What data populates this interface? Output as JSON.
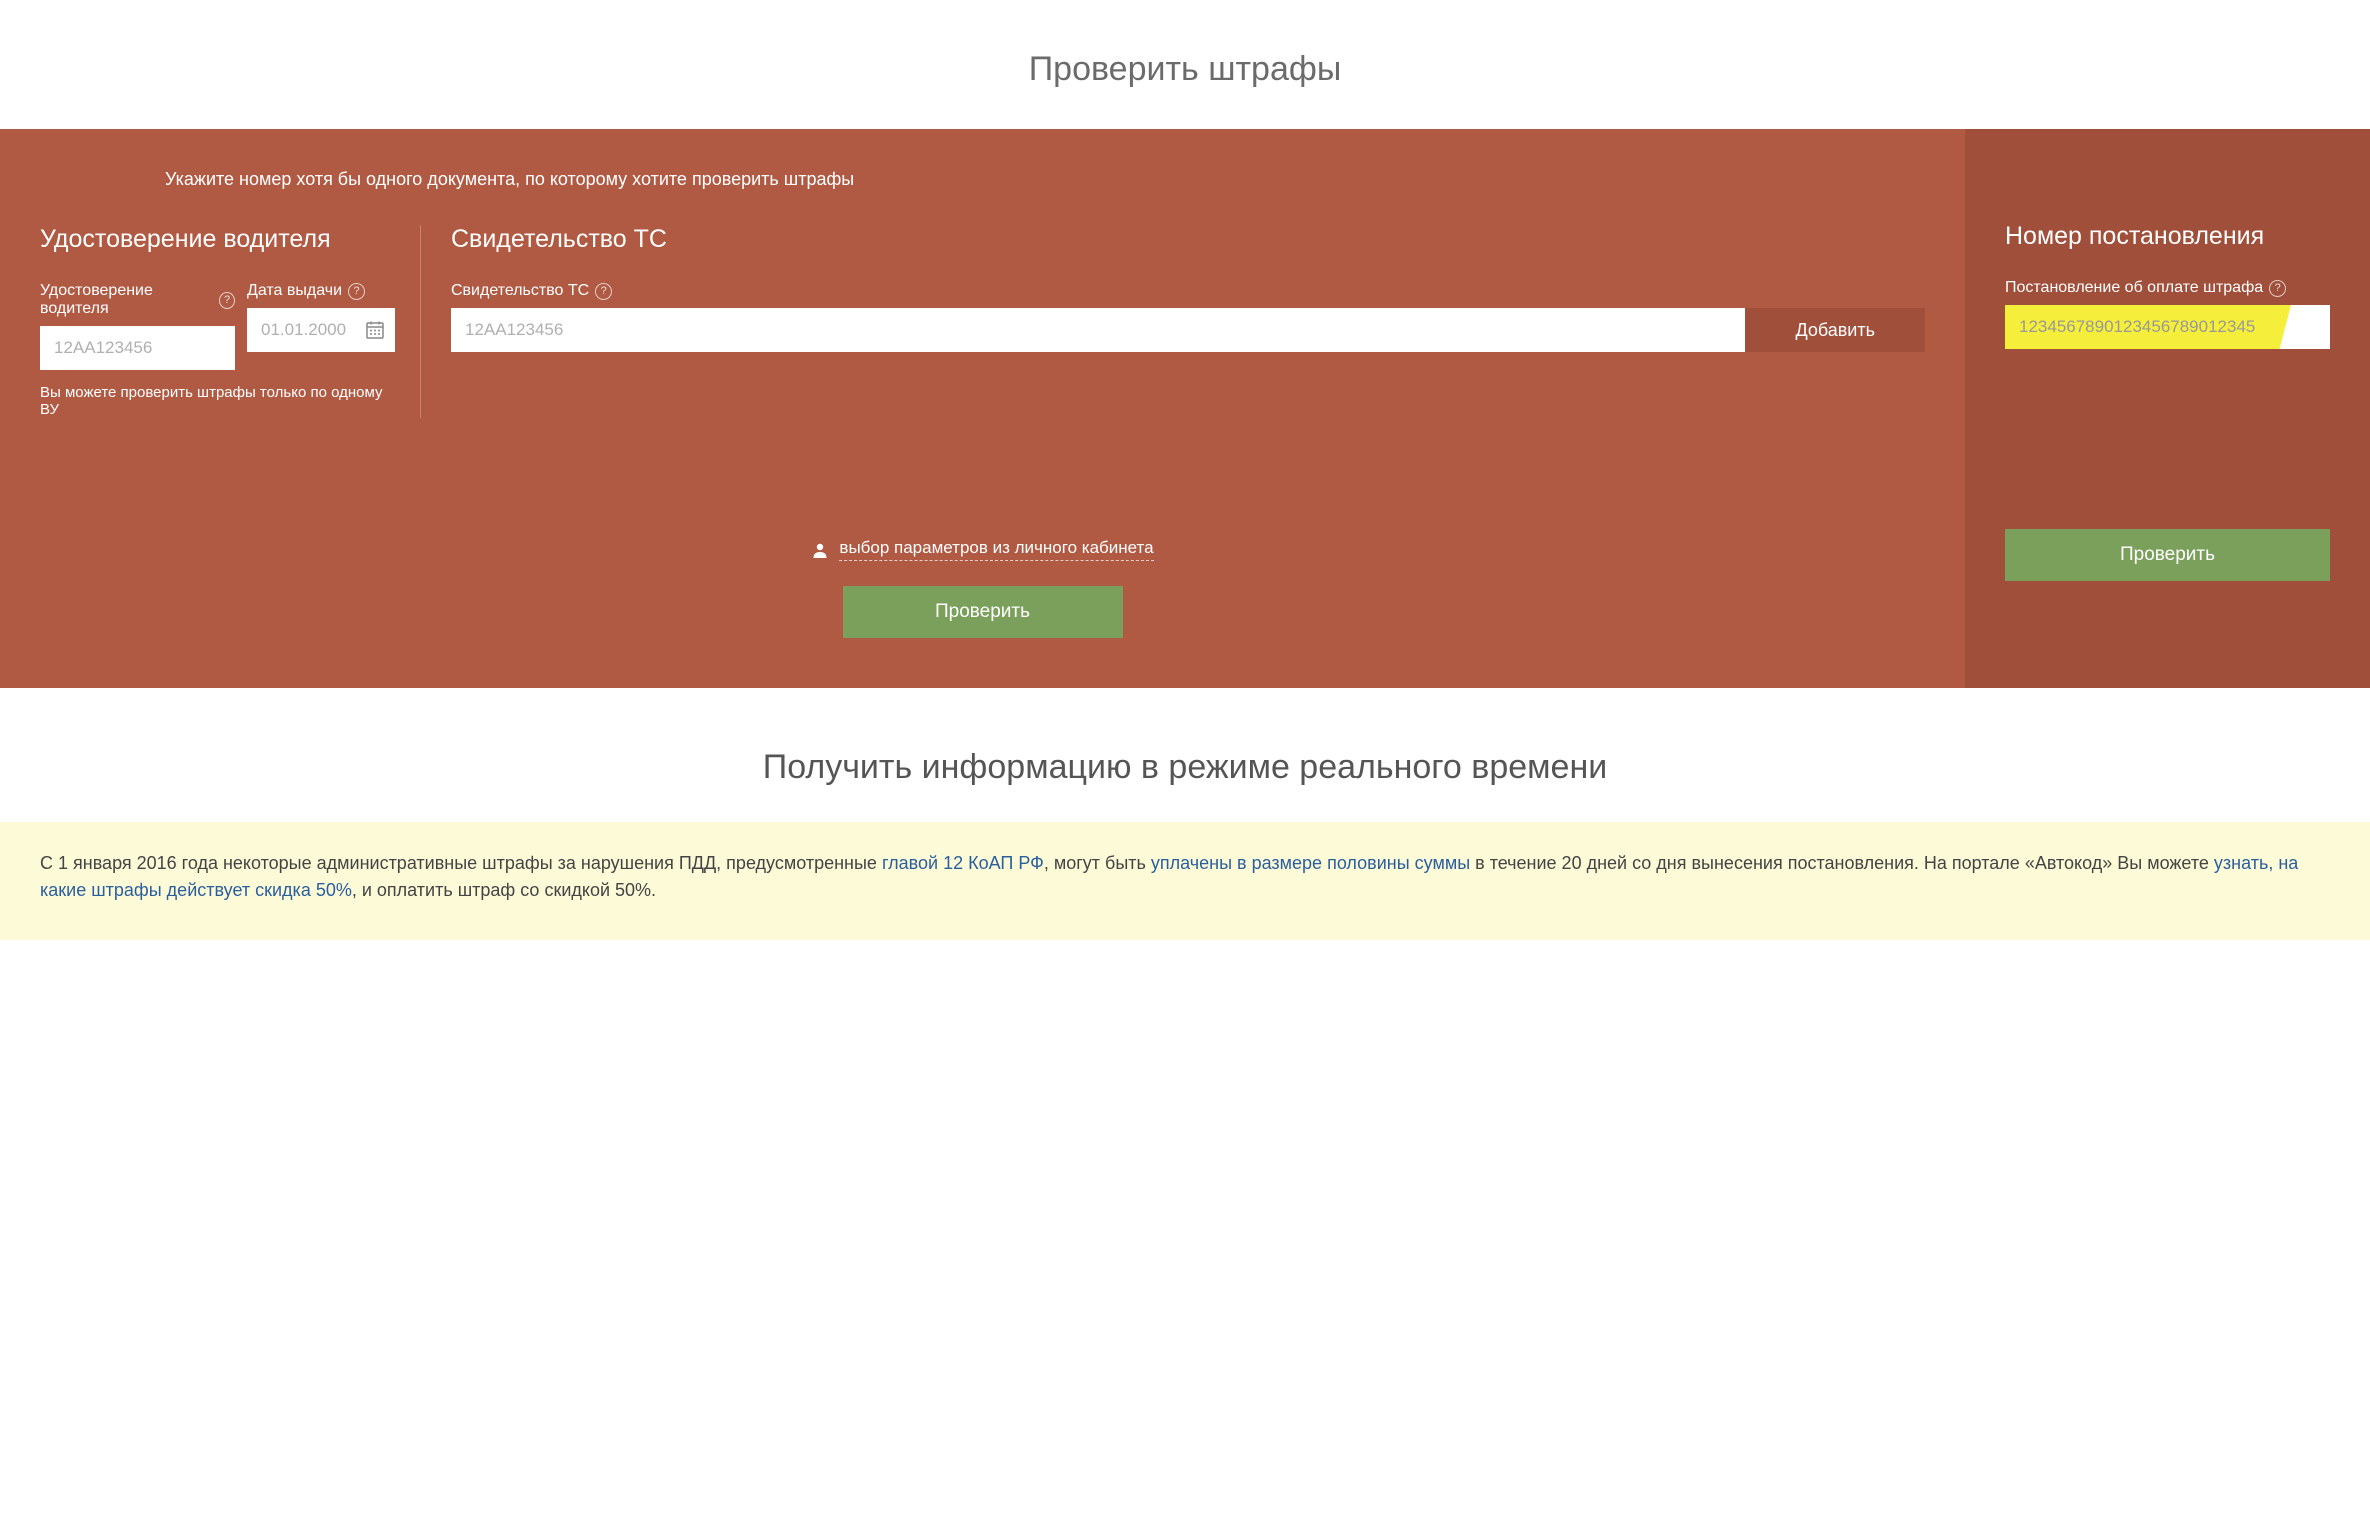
{
  "header": {
    "title": "Проверить штрафы"
  },
  "instruction": "Укажите номер хотя бы одного документа, по которому хотите проверить штрафы",
  "driver": {
    "heading": "Удостоверение водителя",
    "license_label": "Удостоверение водителя",
    "license_placeholder": "12АА123456",
    "date_label": "Дата выдачи",
    "date_placeholder": "01.01.2000",
    "hint": "Вы можете проверить штрафы только по одному ВУ"
  },
  "cert": {
    "heading": "Свидетельство ТС",
    "label": "Свидетельство ТС",
    "placeholder": "12АА123456",
    "add_label": "Добавить"
  },
  "profile_link": "выбор параметров из личного кабинета",
  "check_label": "Проверить",
  "resolution": {
    "heading": "Номер постановления",
    "label": "Постановление об оплате штрафа",
    "value": "1234567890123456789012345"
  },
  "subtitle": "Получить информацию в режиме реального времени",
  "info": {
    "t1": "С 1 января 2016 года некоторые административные штрафы за нарушения ПДД, предусмотренные ",
    "link1": "главой 12 КоАП РФ",
    "t2": ", могут быть ",
    "link2": "уплачены в размере половины суммы",
    "t3": " в течение 20 дней со дня вынесения постановления. На портале «Автокод» Вы можете ",
    "link3": "узнать, на какие штрафы действует скидка 50%",
    "t4": ", и оплатить штраф со скидкой 50%."
  }
}
